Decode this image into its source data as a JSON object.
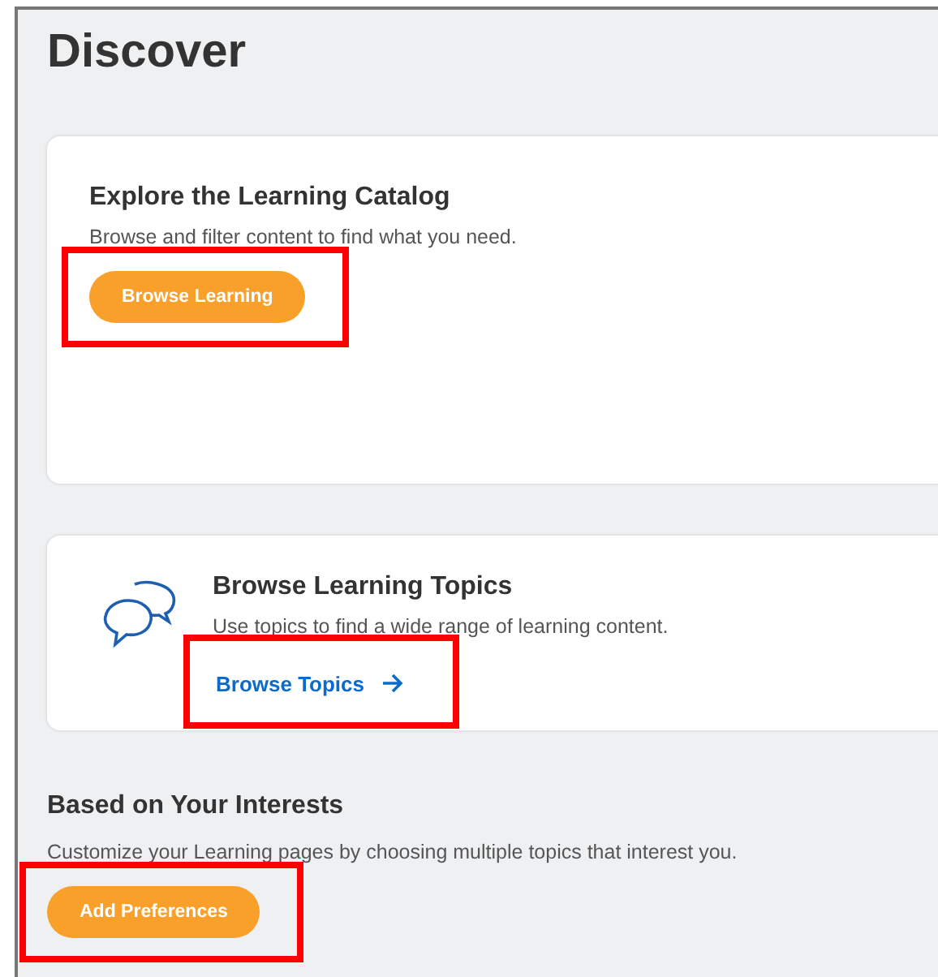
{
  "page": {
    "title": "Discover"
  },
  "cards": [
    {
      "kind": "catalog",
      "title": "Explore the Learning Catalog",
      "description": "Browse and filter content to find what you need.",
      "action": {
        "kind": "button",
        "label": "Browse Learning",
        "highlighted": true
      }
    },
    {
      "kind": "topics",
      "title": "Browse Learning Topics",
      "description": "Use topics to find a wide range of learning content.",
      "action": {
        "kind": "link",
        "label": "Browse Topics",
        "highlighted": true
      }
    }
  ],
  "interests": {
    "title": "Based on Your Interests",
    "description": "Customize your Learning pages by choosing multiple topics that interest you.",
    "action": {
      "kind": "button",
      "label": "Add Preferences",
      "highlighted": true
    }
  }
}
